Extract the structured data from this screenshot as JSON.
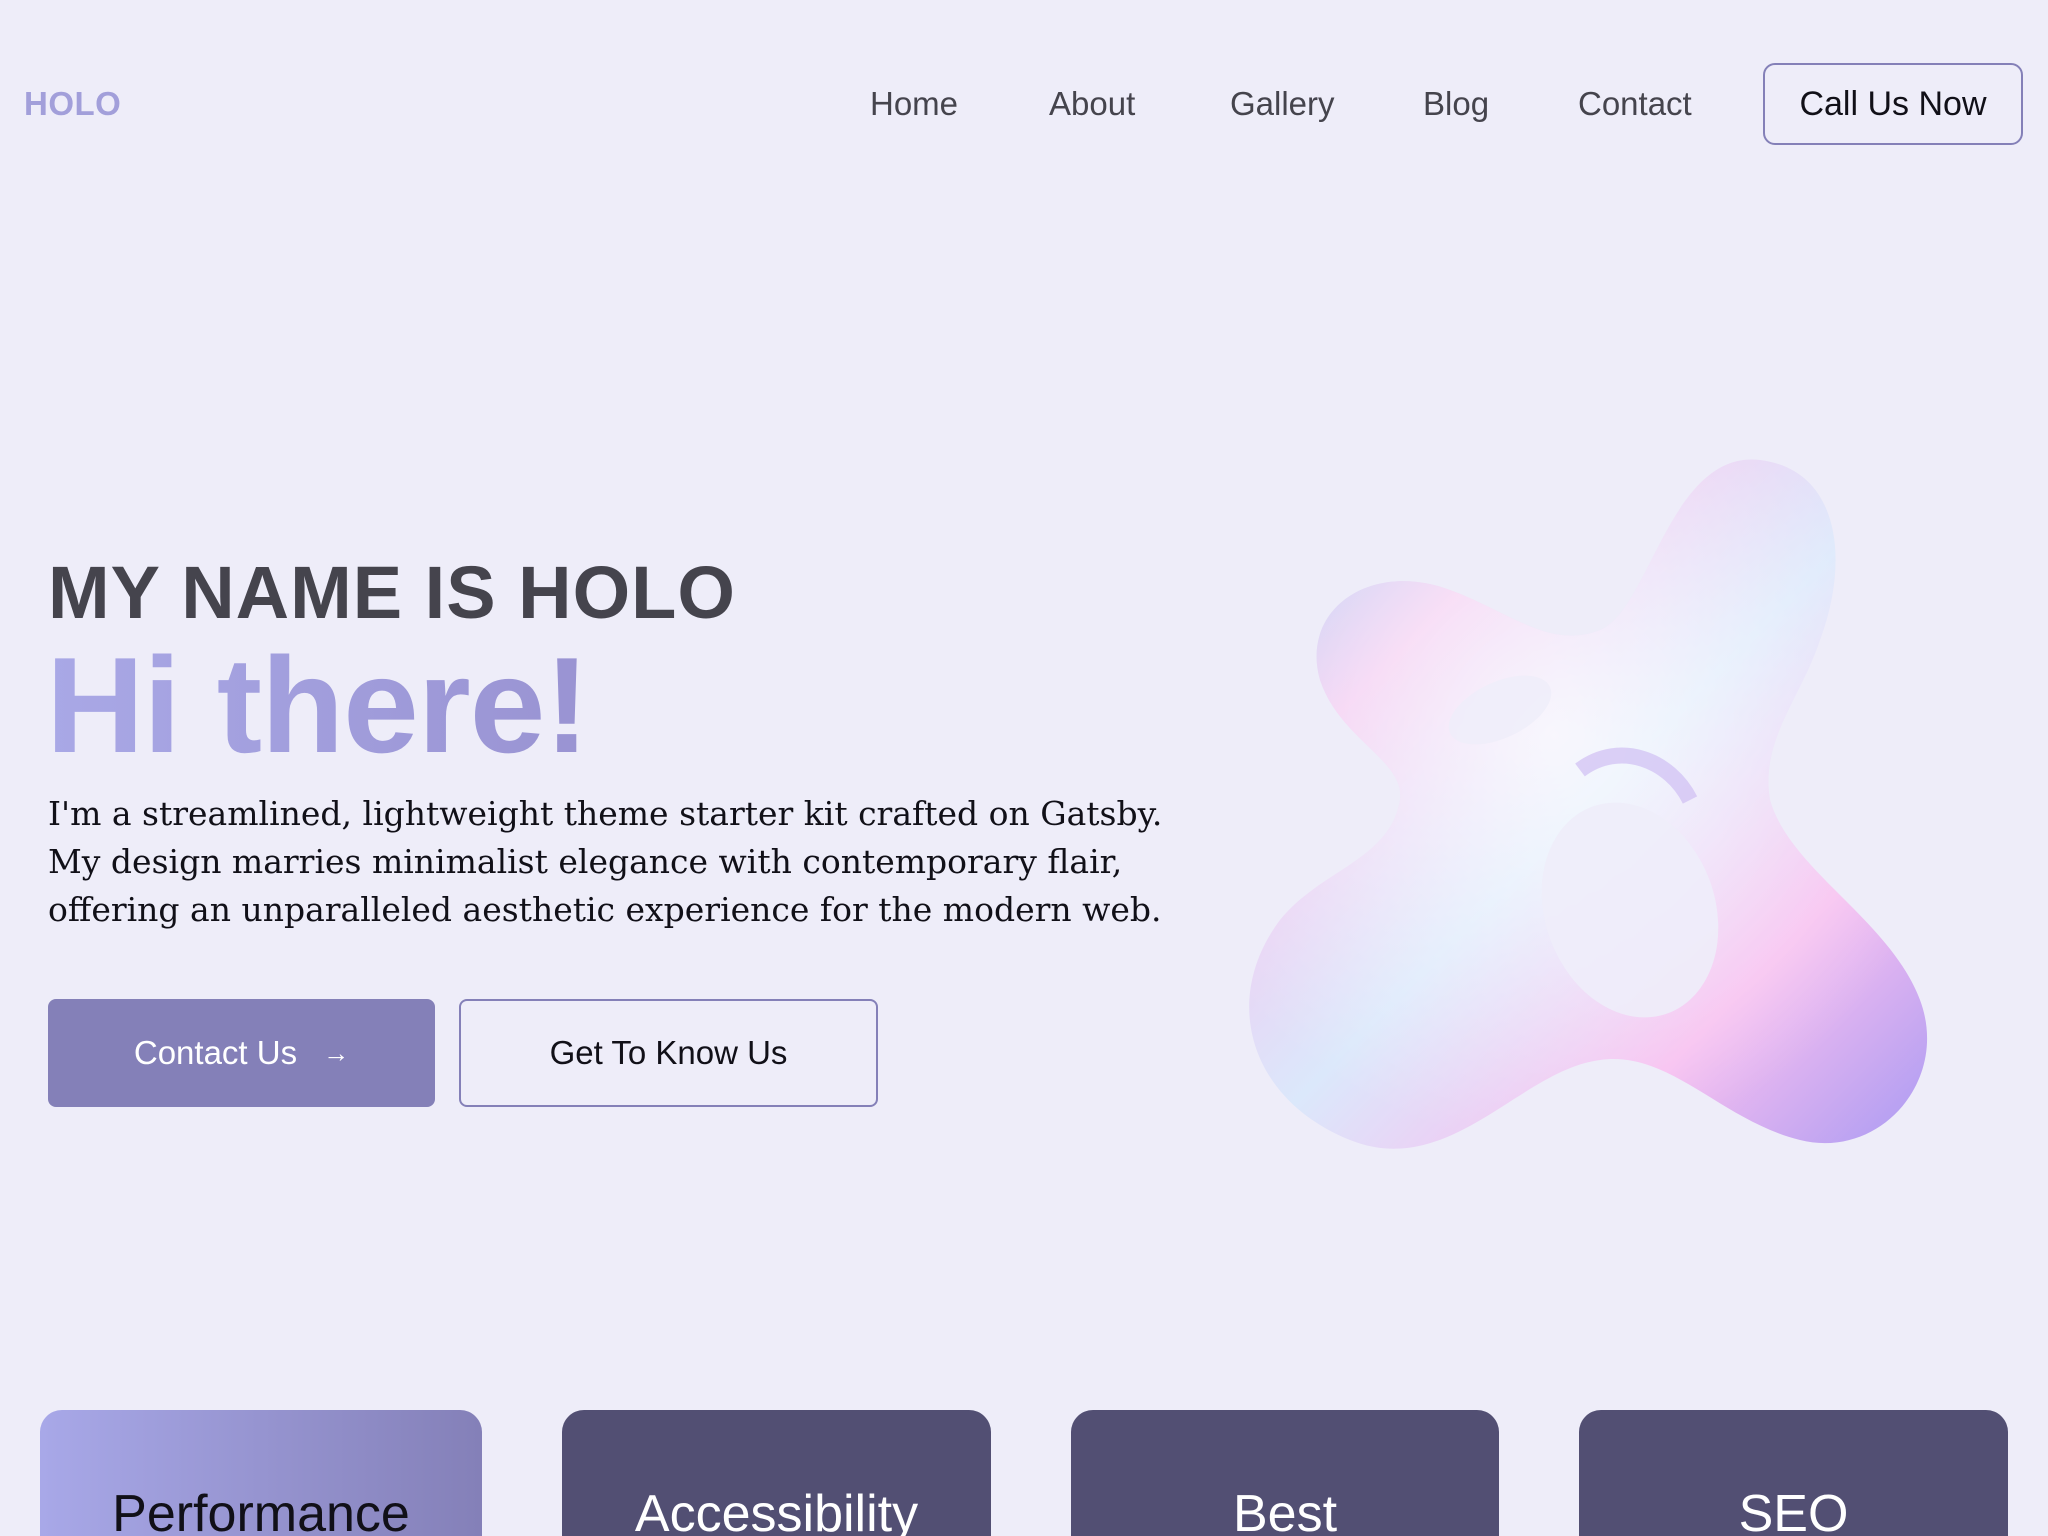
{
  "header": {
    "logo": "HOLO",
    "nav": [
      {
        "label": "Home"
      },
      {
        "label": "About"
      },
      {
        "label": "Gallery"
      },
      {
        "label": "Blog"
      },
      {
        "label": "Contact"
      }
    ],
    "cta_label": "Call Us Now"
  },
  "hero": {
    "name_line": "MY NAME IS HOLO",
    "greeting": "Hi there!",
    "description": [
      "I'm a streamlined, lightweight theme starter kit crafted on Gatsby.",
      "My design marries minimalist elegance with contemporary flair,",
      "offering an unparalleled aesthetic experience for the modern web."
    ],
    "primary_button": {
      "label": "Contact Us",
      "icon": "arrow-right-icon",
      "glyph": "→"
    },
    "secondary_button": {
      "label": "Get To Know Us"
    }
  },
  "features": [
    {
      "label": "Performance",
      "active": true
    },
    {
      "label": "Accessibility",
      "active": false
    },
    {
      "label": "Best",
      "active": false
    },
    {
      "label": "SEO",
      "active": false
    }
  ],
  "colors": {
    "background": "#eeedf9",
    "accent": "#8480b8",
    "logo": "#a29fda",
    "card_dark": "#524f73",
    "text": "#45444d"
  }
}
